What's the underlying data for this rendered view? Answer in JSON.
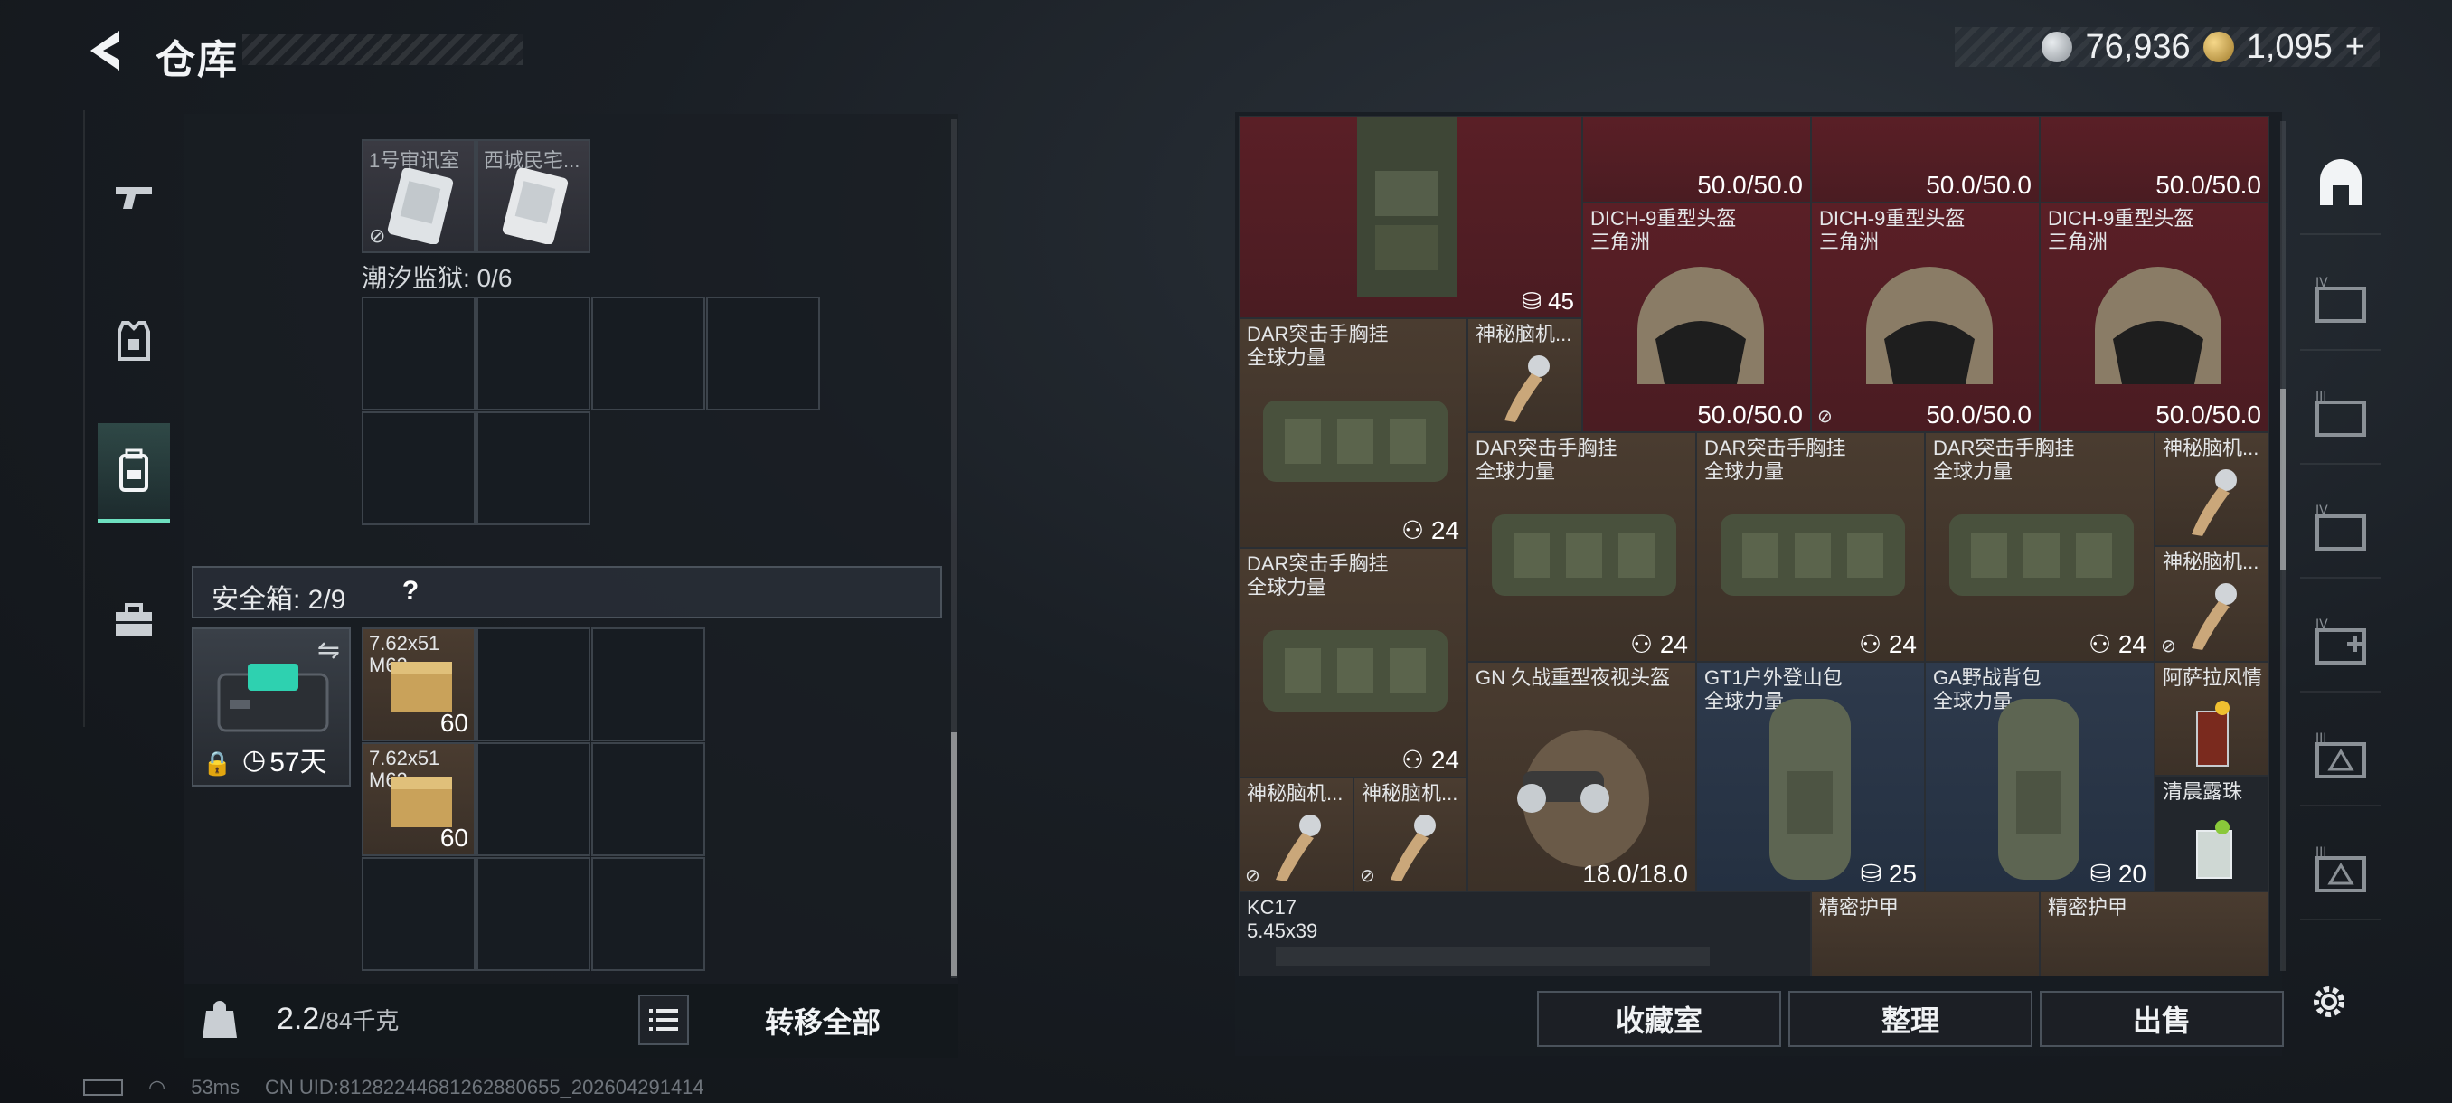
{
  "header": {
    "title": "仓库",
    "currency": [
      {
        "icon": "silver-coin-icon",
        "value": "76,936"
      },
      {
        "icon": "gold-coin-icon",
        "value": "1,095"
      }
    ],
    "add_label": "+"
  },
  "left_nav": [
    "gun-icon",
    "armor-vest-icon",
    "backpack-icon",
    "toolbox-icon"
  ],
  "left_panel": {
    "top_items": [
      {
        "label": "1号审讯室"
      },
      {
        "label": "西城民宅..."
      }
    ],
    "tide_label": "潮汐监狱: 0/6",
    "safe_box": {
      "label": "安全箱: 2/9",
      "help": "?",
      "days": "57天",
      "items": [
        {
          "label": "7.62x51 M62",
          "count": "60"
        },
        {
          "label": "7.62x51 M62",
          "count": "60"
        }
      ]
    },
    "weight": {
      "current": "2.2",
      "max": "/84千克"
    },
    "transfer_all": "转移全部"
  },
  "status": {
    "ping": "53ms",
    "uid": "CN UID:81282244681262880655_202604291414"
  },
  "grid_items": [
    {
      "id": "vest-top",
      "name": "",
      "value": "45",
      "icon": "weight-icon"
    },
    {
      "id": "h1",
      "name": "",
      "value": "50.0/50.0"
    },
    {
      "id": "h2",
      "name": "",
      "value": "50.0/50.0"
    },
    {
      "id": "h3",
      "name": "",
      "value": "50.0/50.0"
    },
    {
      "id": "dich1",
      "name": "DICH-9重型头盔",
      "sub": "三角洲",
      "value": "50.0/50.0"
    },
    {
      "id": "dich2",
      "name": "DICH-9重型头盔",
      "sub": "三角洲",
      "value": "50.0/50.0"
    },
    {
      "id": "dich3",
      "name": "DICH-9重型头盔",
      "sub": "三角洲",
      "value": "50.0/50.0"
    },
    {
      "id": "dar1",
      "name": "DAR突击手胸挂",
      "sub": "全球力量",
      "value": "24"
    },
    {
      "id": "brain1",
      "name": "神秘脑机..."
    },
    {
      "id": "dar2",
      "name": "DAR突击手胸挂",
      "sub": "全球力量",
      "value": "24"
    },
    {
      "id": "dar3",
      "name": "DAR突击手胸挂",
      "sub": "全球力量",
      "value": "24"
    },
    {
      "id": "dar4",
      "name": "DAR突击手胸挂",
      "sub": "全球力量",
      "value": "24"
    },
    {
      "id": "brain2",
      "name": "神秘脑机..."
    },
    {
      "id": "dar5",
      "name": "DAR突击手胸挂",
      "sub": "全球力量",
      "value": "24"
    },
    {
      "id": "brain3",
      "name": "神秘脑机..."
    },
    {
      "id": "gn",
      "name": "GN 久战重型夜视头盔",
      "value": "18.0/18.0"
    },
    {
      "id": "gt1",
      "name": "GT1户外登山包",
      "sub": "全球力量",
      "value": "25"
    },
    {
      "id": "ga",
      "name": "GA野战背包",
      "sub": "全球力量",
      "value": "20"
    },
    {
      "id": "drink1",
      "name": "阿萨拉风情"
    },
    {
      "id": "brain4",
      "name": "神秘脑机..."
    },
    {
      "id": "brain5",
      "name": "神秘脑机..."
    },
    {
      "id": "drink2",
      "name": "清晨露珠"
    },
    {
      "id": "kc17",
      "name": "KC17",
      "sub": "5.45x39"
    },
    {
      "id": "armor1",
      "name": "精密护甲"
    },
    {
      "id": "armor2",
      "name": "精密护甲"
    }
  ],
  "right_tabs": [
    "vault-icon",
    "tab-iv-gallery-icon",
    "tab-iii-gallery-icon",
    "tab-iv-folder-icon",
    "tab-iv-add-icon",
    "tab-iii-delta-icon",
    "tab-iii-delta-2-icon"
  ],
  "buttons": {
    "collection": "收藏室",
    "organize": "整理",
    "sell": "出售"
  }
}
